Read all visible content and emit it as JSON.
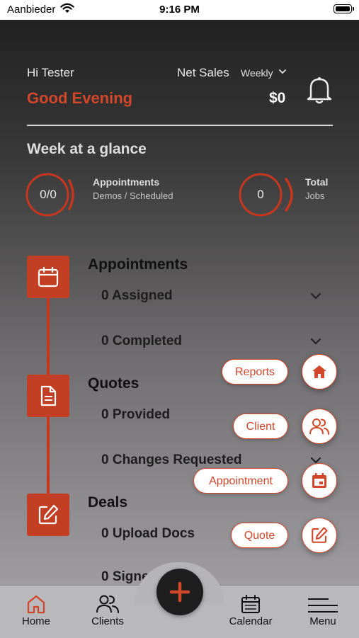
{
  "status_bar": {
    "carrier": "Aanbieder",
    "time": "9:16 PM"
  },
  "header": {
    "greeting": "Hi Tester",
    "salutation": "Good Evening",
    "net_sales_label": "Net Sales",
    "period": "Weekly",
    "amount": "$0"
  },
  "glance": {
    "title": "Week at a glance",
    "appointments": {
      "value": "0/0",
      "label": "Appointments",
      "sub": "Demos / Scheduled"
    },
    "jobs": {
      "value": "0",
      "label": "Total",
      "sub": "Jobs"
    }
  },
  "sections": {
    "appointments": {
      "title": "Appointments",
      "rows": [
        "0 Assigned",
        "0 Completed"
      ]
    },
    "quotes": {
      "title": "Quotes",
      "rows": [
        "0 Provided",
        "0 Changes Requested"
      ]
    },
    "deals": {
      "title": "Deals",
      "rows": [
        "0 Upload Docs",
        "0 Signe"
      ]
    }
  },
  "fab_menu": [
    {
      "label": "Reports",
      "icon": "home-icon"
    },
    {
      "label": "Client",
      "icon": "users-icon"
    },
    {
      "label": "Appointment",
      "icon": "calendar-icon"
    },
    {
      "label": "Quote",
      "icon": "edit-icon"
    }
  ],
  "tabbar": {
    "home": "Home",
    "clients": "Clients",
    "calendar": "Calendar",
    "menu": "Menu"
  },
  "colors": {
    "accent": "#d2462a",
    "timeline": "#c23f24",
    "dark": "#1e1e1e"
  }
}
